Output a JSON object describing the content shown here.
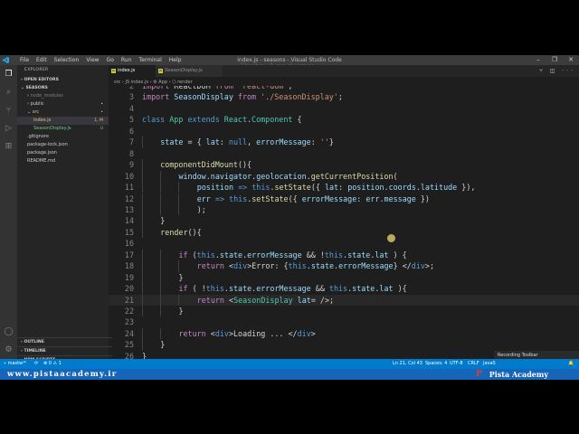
{
  "window": {
    "title": "index.js - seasons - Visual Studio Code",
    "menu": [
      "File",
      "Edit",
      "Selection",
      "View",
      "Go",
      "Run",
      "Terminal",
      "Help"
    ],
    "controls": {
      "minimize": "–",
      "maximize": "❐",
      "close": "✕"
    }
  },
  "watermark": "Pista Academy",
  "explorer": {
    "header": "EXPLORER",
    "open_editors": "OPEN EDITORS",
    "project": "SEASONS",
    "tree": [
      {
        "label": "node_modules",
        "indent": 1,
        "kind": "folder",
        "badge": "",
        "color": "#7f7f7f"
      },
      {
        "label": "public",
        "indent": 1,
        "kind": "folder",
        "badge": "•",
        "color": "#cccccc"
      },
      {
        "label": "src",
        "indent": 1,
        "kind": "folder-open",
        "badge": "•",
        "color": "#e2c08d"
      },
      {
        "label": "index.js",
        "indent": 2,
        "kind": "file",
        "badge": "1, M",
        "color": "#e2c08d",
        "selected": true
      },
      {
        "label": "SeasonDisplay.js",
        "indent": 2,
        "kind": "file",
        "badge": "U",
        "color": "#73c991"
      },
      {
        "label": ".gitignore",
        "indent": 1,
        "kind": "file",
        "badge": "",
        "color": "#cccccc"
      },
      {
        "label": "package-lock.json",
        "indent": 1,
        "kind": "file",
        "badge": "",
        "color": "#cccccc"
      },
      {
        "label": "package.json",
        "indent": 1,
        "kind": "file",
        "badge": "",
        "color": "#cccccc"
      },
      {
        "label": "README.md",
        "indent": 1,
        "kind": "file",
        "badge": "",
        "color": "#cccccc"
      }
    ],
    "outline": "OUTLINE",
    "timeline": "TIMELINE",
    "npm_scripts": "NPM SCRIPTS"
  },
  "tabs": [
    {
      "label": "index.js",
      "active": true,
      "close": "×"
    },
    {
      "label": "SeasonDisplay.js",
      "active": false,
      "close": ""
    }
  ],
  "tab_actions": "⑂ ◫ ···",
  "breadcrumb": "src  ›  JS index.js  ›  ⚙ App  ›  ⬡ render",
  "editor": {
    "current_line": 21,
    "lines": [
      {
        "n": "2",
        "tokens": [
          [
            "kc",
            "import"
          ],
          [
            "pun",
            " ReactDOM "
          ],
          [
            "kc",
            "from"
          ],
          [
            "str",
            " 'react-dom'"
          ],
          [
            "pun",
            ";"
          ]
        ],
        "indent": 0,
        "partial": true
      },
      {
        "n": "3",
        "tokens": [
          [
            "kc",
            "import"
          ],
          [
            "var",
            " SeasonDisplay "
          ],
          [
            "kc",
            "from"
          ],
          [
            "str",
            " './SeasonDisplay'"
          ],
          [
            "pun",
            ";"
          ]
        ],
        "indent": 0
      },
      {
        "n": "4",
        "tokens": [],
        "indent": 0
      },
      {
        "n": "5",
        "tokens": [
          [
            "kw",
            "class"
          ],
          [
            "cls",
            " App "
          ],
          [
            "kw",
            "extends"
          ],
          [
            "cls",
            " React"
          ],
          [
            "pun",
            "."
          ],
          [
            "cls",
            "Component"
          ],
          [
            "pun",
            " {"
          ]
        ],
        "indent": 0
      },
      {
        "n": "6",
        "tokens": [],
        "indent": 0
      },
      {
        "n": "7",
        "tokens": [
          [
            "var",
            "state"
          ],
          [
            "pun",
            " = { "
          ],
          [
            "var",
            "lat"
          ],
          [
            "pun",
            ": "
          ],
          [
            "kw",
            "null"
          ],
          [
            "pun",
            ", "
          ],
          [
            "var",
            "errorMessage"
          ],
          [
            "pun",
            ": "
          ],
          [
            "str",
            "''"
          ],
          [
            "pun",
            "}"
          ]
        ],
        "indent": 1
      },
      {
        "n": "8",
        "tokens": [],
        "indent": 0
      },
      {
        "n": "9",
        "tokens": [
          [
            "fn",
            "componentDidMount"
          ],
          [
            "pun",
            "(){"
          ]
        ],
        "indent": 1
      },
      {
        "n": "10",
        "tokens": [
          [
            "var",
            "window"
          ],
          [
            "pun",
            "."
          ],
          [
            "var",
            "navigator"
          ],
          [
            "pun",
            "."
          ],
          [
            "var",
            "geolocation"
          ],
          [
            "pun",
            "."
          ],
          [
            "fn",
            "getCurrentPosition"
          ],
          [
            "pun",
            "("
          ]
        ],
        "indent": 2
      },
      {
        "n": "11",
        "tokens": [
          [
            "var",
            "position"
          ],
          [
            "kw",
            " =>"
          ],
          [
            "kw",
            " this"
          ],
          [
            "pun",
            "."
          ],
          [
            "fn",
            "setState"
          ],
          [
            "pun",
            "({ "
          ],
          [
            "var",
            "lat"
          ],
          [
            "pun",
            ": "
          ],
          [
            "var",
            "position"
          ],
          [
            "pun",
            "."
          ],
          [
            "var",
            "coords"
          ],
          [
            "pun",
            "."
          ],
          [
            "var",
            "latitude"
          ],
          [
            "pun",
            " }),"
          ]
        ],
        "indent": 3
      },
      {
        "n": "12",
        "tokens": [
          [
            "var",
            "err"
          ],
          [
            "kw",
            " =>"
          ],
          [
            "kw",
            " this"
          ],
          [
            "pun",
            "."
          ],
          [
            "fn",
            "setState"
          ],
          [
            "pun",
            "({ "
          ],
          [
            "var",
            "errorMessage"
          ],
          [
            "pun",
            ": "
          ],
          [
            "var",
            "err"
          ],
          [
            "pun",
            "."
          ],
          [
            "var",
            "message"
          ],
          [
            "pun",
            " })"
          ]
        ],
        "indent": 3
      },
      {
        "n": "13",
        "tokens": [
          [
            "pun",
            ");"
          ]
        ],
        "indent": 3
      },
      {
        "n": "14",
        "tokens": [
          [
            "pun",
            "}"
          ]
        ],
        "indent": 1
      },
      {
        "n": "15",
        "tokens": [
          [
            "fn",
            "render"
          ],
          [
            "pun",
            "(){"
          ]
        ],
        "indent": 1
      },
      {
        "n": "16",
        "tokens": [],
        "indent": 0
      },
      {
        "n": "17",
        "tokens": [
          [
            "kc",
            "if"
          ],
          [
            "pun",
            " ("
          ],
          [
            "kw",
            "this"
          ],
          [
            "pun",
            "."
          ],
          [
            "var",
            "state"
          ],
          [
            "pun",
            "."
          ],
          [
            "var",
            "errorMessage"
          ],
          [
            "pun",
            " && !"
          ],
          [
            "kw",
            "this"
          ],
          [
            "pun",
            "."
          ],
          [
            "var",
            "state"
          ],
          [
            "pun",
            "."
          ],
          [
            "var",
            "lat"
          ],
          [
            "pun",
            " ) {"
          ]
        ],
        "indent": 2
      },
      {
        "n": "18",
        "tokens": [
          [
            "kc",
            "return"
          ],
          [
            "pun",
            " <"
          ],
          [
            "tag",
            "div"
          ],
          [
            "pun",
            ">Error: {"
          ],
          [
            "kw",
            "this"
          ],
          [
            "pun",
            "."
          ],
          [
            "var",
            "state"
          ],
          [
            "pun",
            "."
          ],
          [
            "var",
            "errorMessage"
          ],
          [
            "pun",
            "} </"
          ],
          [
            "tag",
            "div"
          ],
          [
            "pun",
            ">;"
          ]
        ],
        "indent": 3
      },
      {
        "n": "19",
        "tokens": [
          [
            "pun",
            "}"
          ]
        ],
        "indent": 2
      },
      {
        "n": "20",
        "tokens": [
          [
            "kc",
            "if"
          ],
          [
            "pun",
            " ( !"
          ],
          [
            "kw",
            "this"
          ],
          [
            "pun",
            "."
          ],
          [
            "var",
            "state"
          ],
          [
            "pun",
            "."
          ],
          [
            "var",
            "errorMessage"
          ],
          [
            "pun",
            " && "
          ],
          [
            "kw",
            "this"
          ],
          [
            "pun",
            "."
          ],
          [
            "var",
            "state"
          ],
          [
            "pun",
            "."
          ],
          [
            "var",
            "lat"
          ],
          [
            "pun",
            " ){"
          ]
        ],
        "indent": 2
      },
      {
        "n": "21",
        "tokens": [
          [
            "kc",
            "return"
          ],
          [
            "pun",
            " <"
          ],
          [
            "cls",
            "SeasonDisplay"
          ],
          [
            "var",
            " lat"
          ],
          [
            "pun",
            "= "
          ],
          [
            "pun",
            "/>;"
          ]
        ],
        "indent": 3
      },
      {
        "n": "22",
        "tokens": [
          [
            "pun",
            "}"
          ]
        ],
        "indent": 2
      },
      {
        "n": "23",
        "tokens": [],
        "indent": 0
      },
      {
        "n": "24",
        "tokens": [
          [
            "kc",
            "return"
          ],
          [
            "pun",
            " <"
          ],
          [
            "tag",
            "div"
          ],
          [
            "pun",
            ">Loading ... </"
          ],
          [
            "tag",
            "div"
          ],
          [
            "pun",
            ">"
          ]
        ],
        "indent": 2
      },
      {
        "n": "25",
        "tokens": [
          [
            "pun",
            "}"
          ]
        ],
        "indent": 1
      },
      {
        "n": "26",
        "tokens": [
          [
            "pun",
            "}"
          ]
        ],
        "indent": 0
      }
    ]
  },
  "recording_toolbar": "Recording Toolbar",
  "statusbar": {
    "branch": "⑂ master*",
    "sync": "⟳",
    "problems": "⊗ 0  ⚠ 1",
    "position": "Ln 21, Col 43",
    "spaces": "Spaces: 4",
    "encoding": "UTF-8",
    "eol": "CRLF",
    "language": "JavaS",
    "bell": "🔔"
  },
  "banner": {
    "url": "www.pistaacademy.ir",
    "brand": "Pista Academy",
    "logo_letter": "P"
  },
  "colors": {
    "accent": "#007acc",
    "banner": "#1565b8",
    "editor_bg": "#1e1e1e",
    "sidebar_bg": "#252526"
  }
}
